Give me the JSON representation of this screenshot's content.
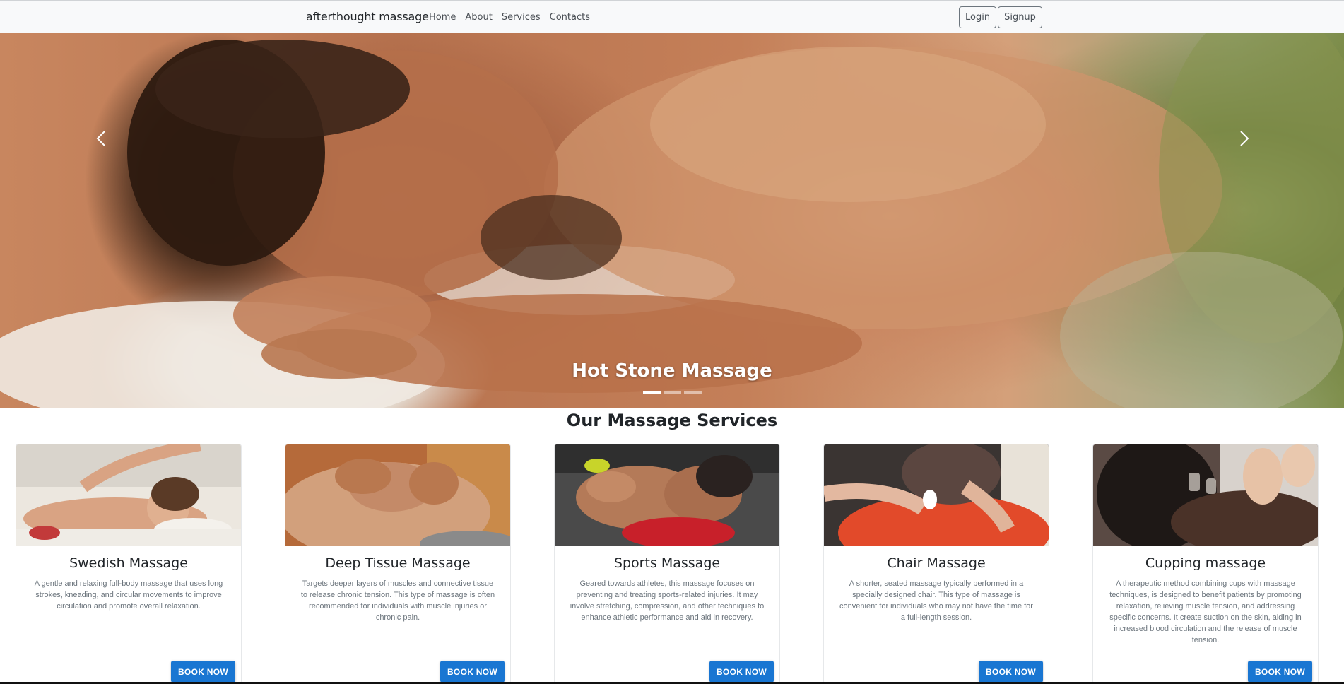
{
  "navbar": {
    "brand": "afterthought massage",
    "links": [
      "Home",
      "About",
      "Services",
      "Contacts"
    ],
    "login_label": "Login",
    "signup_label": "Signup"
  },
  "hero": {
    "caption": "Hot Stone Massage",
    "slide_count": 3,
    "active_slide": 1
  },
  "services": {
    "title": "Our Massage Services",
    "cards": [
      {
        "title": "Swedish Massage",
        "text": "A gentle and relaxing full-body massage that uses long strokes, kneading, and circular movements to improve circulation and promote overall relaxation.",
        "button": "BOOK NOW"
      },
      {
        "title": "Deep Tissue Massage",
        "text": "Targets deeper layers of muscles and connective tissue to release chronic tension. This type of massage is often recommended for individuals with muscle injuries or chronic pain.",
        "button": "BOOK NOW"
      },
      {
        "title": "Sports Massage",
        "text": "Geared towards athletes, this massage focuses on preventing and treating sports-related injuries. It may involve stretching, compression, and other techniques to enhance athletic performance and aid in recovery.",
        "button": "BOOK NOW"
      },
      {
        "title": "Chair Massage",
        "text": "A shorter, seated massage typically performed in a specially designed chair. This type of massage is convenient for individuals who may not have the time for a full-length session.",
        "button": "BOOK NOW"
      },
      {
        "title": "Cupping massage",
        "text": "A therapeutic method combining cups with massage techniques, is designed to benefit patients by promoting relaxation, relieving muscle tension, and addressing specific concerns. It create suction on the skin, aiding in increased blood circulation and the release of muscle tension.",
        "button": "BOOK NOW"
      }
    ]
  },
  "colors": {
    "navbar_bg": "#f8f9fa",
    "primary_button": "#1976d2",
    "text_muted": "#6c757d"
  }
}
